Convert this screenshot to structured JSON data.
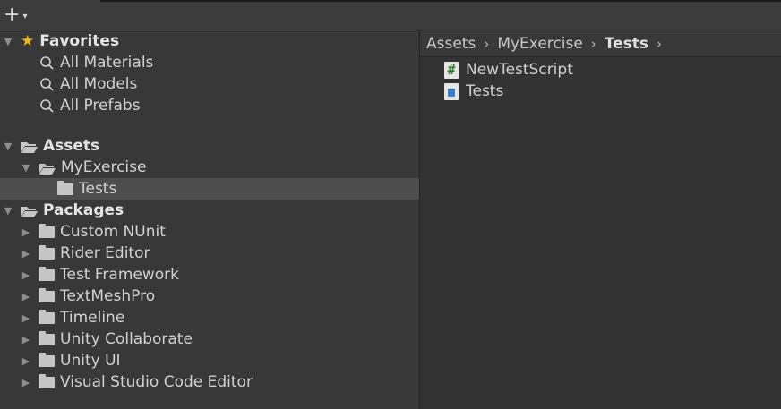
{
  "toolbar": {
    "create_icon": "plus-icon",
    "dropdown_icon": "caret-down-icon",
    "plus_glyph": "+",
    "caret_glyph": "▾"
  },
  "tree": {
    "favorites": {
      "label": "Favorites",
      "items": [
        "All Materials",
        "All Models",
        "All Prefabs"
      ]
    },
    "assets": {
      "label": "Assets",
      "children": [
        {
          "label": "MyExercise",
          "children": [
            {
              "label": "Tests",
              "selected": true
            }
          ]
        }
      ]
    },
    "packages": {
      "label": "Packages",
      "items": [
        "Custom NUnit",
        "Rider Editor",
        "Test Framework",
        "TextMeshPro",
        "Timeline",
        "Unity Collaborate",
        "Unity UI",
        "Visual Studio Code Editor"
      ]
    }
  },
  "breadcrumb": [
    "Assets",
    "MyExercise",
    "Tests"
  ],
  "breadcrumb_separator": "›",
  "files": [
    {
      "name": "NewTestScript",
      "icon": "csharp-script-icon",
      "glyph": "#"
    },
    {
      "name": "Tests",
      "icon": "assembly-definition-icon"
    }
  ],
  "glyphs": {
    "expanded": "▼",
    "collapsed": "▶",
    "star": "★"
  },
  "colors": {
    "star": "#f2b61d",
    "selection": "#4d4d4d",
    "background": "#383838"
  }
}
